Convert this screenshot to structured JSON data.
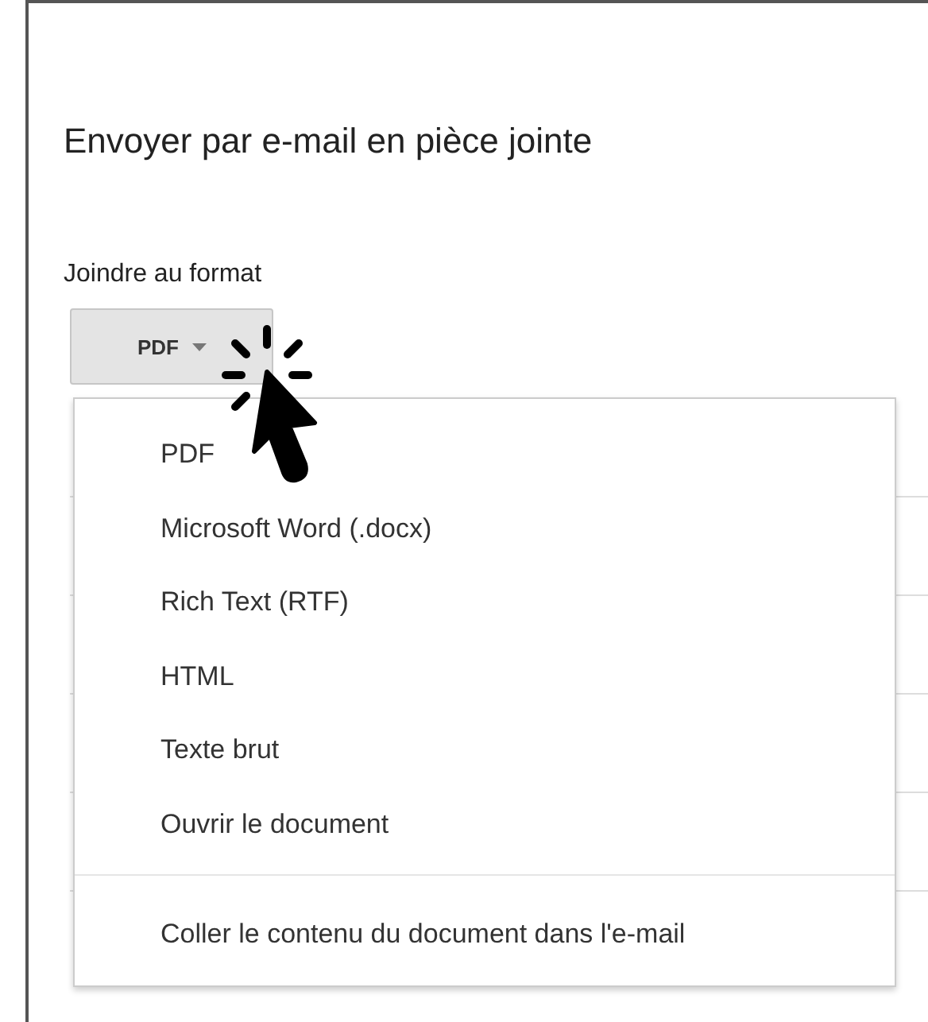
{
  "dialog": {
    "title": "Envoyer par e-mail en pièce jointe"
  },
  "format_label": "Joindre au format",
  "format_button": {
    "label": "PDF",
    "expanded": true
  },
  "menu": {
    "groups": [
      [
        "PDF",
        "Microsoft Word (.docx)",
        "Rich Text (RTF)",
        "HTML",
        "Texte brut",
        "Ouvrir le document"
      ],
      [
        "Coller le contenu du document dans l'e-mail"
      ]
    ]
  }
}
